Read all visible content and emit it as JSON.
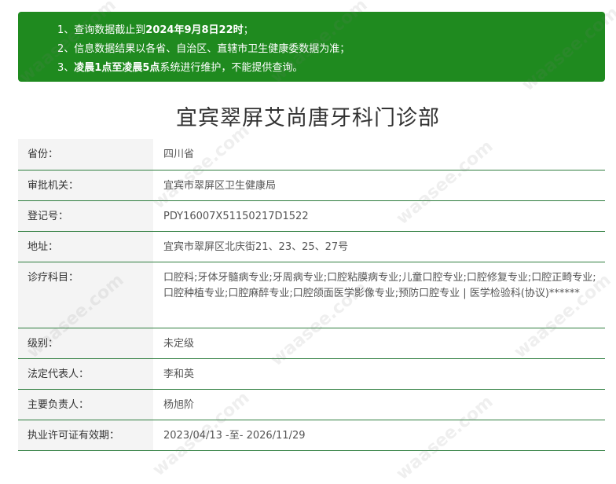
{
  "notice": {
    "line1_prefix": "1、查询数据截止到",
    "line1_bold": "2024年9月8日22时",
    "line1_suffix": "；",
    "line2": "2、信息数据结果以各省、自治区、直辖市卫生健康委数据为准；",
    "line3_prefix": "3、",
    "line3_bold": "凌晨1点至凌晨5点",
    "line3_suffix": "系统进行维护，不能提供查询。"
  },
  "title": "宜宾翠屏艾尚唐牙科门诊部",
  "rows": [
    {
      "label": "省份：",
      "value": "四川省"
    },
    {
      "label": "审批机关：",
      "value": "宜宾市翠屏区卫生健康局"
    },
    {
      "label": "登记号：",
      "value": "PDY16007X51150217D1522"
    },
    {
      "label": "地址：",
      "value": "宜宾市翠屏区北庆街21、23、25、27号"
    },
    {
      "label": "诊疗科目：",
      "value": "口腔科;牙体牙髓病专业;牙周病专业;口腔粘膜病专业;儿童口腔专业;口腔修复专业;口腔正畸专业;口腔种植专业;口腔麻醉专业;口腔颌面医学影像专业;预防口腔专业 | 医学检验科(协议)******"
    },
    {
      "label": "级别：",
      "value": "未定级"
    },
    {
      "label": "法定代表人：",
      "value": "李和英"
    },
    {
      "label": "主要负责人：",
      "value": "杨旭阶"
    },
    {
      "label": "执业许可证有效期：",
      "value": "2023/04/13 -至- 2026/11/29"
    }
  ],
  "watermark": "waasee.com"
}
